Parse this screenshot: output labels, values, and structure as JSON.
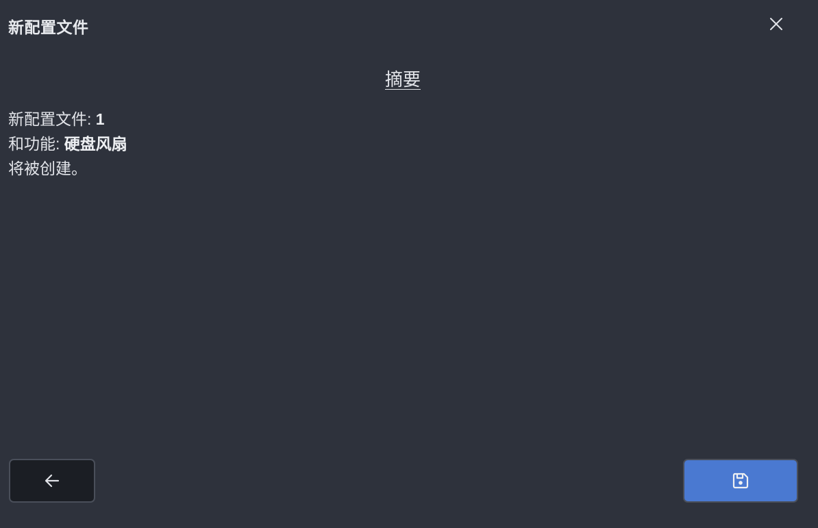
{
  "dialog": {
    "title": "新配置文件",
    "close_icon": "close-icon"
  },
  "summary": {
    "heading": "摘要",
    "profile_label": "新配置文件: ",
    "profile_value": "1",
    "function_label": "和功能: ",
    "function_value": "硬盘风扇",
    "closing_text": "将被创建。"
  },
  "footer": {
    "back_icon": "arrow-left-icon",
    "save_icon": "save-icon"
  },
  "colors": {
    "background": "#2e323c",
    "back_button": "#1b1e24",
    "save_button": "#4a79d1",
    "text": "#e2e4e9"
  }
}
